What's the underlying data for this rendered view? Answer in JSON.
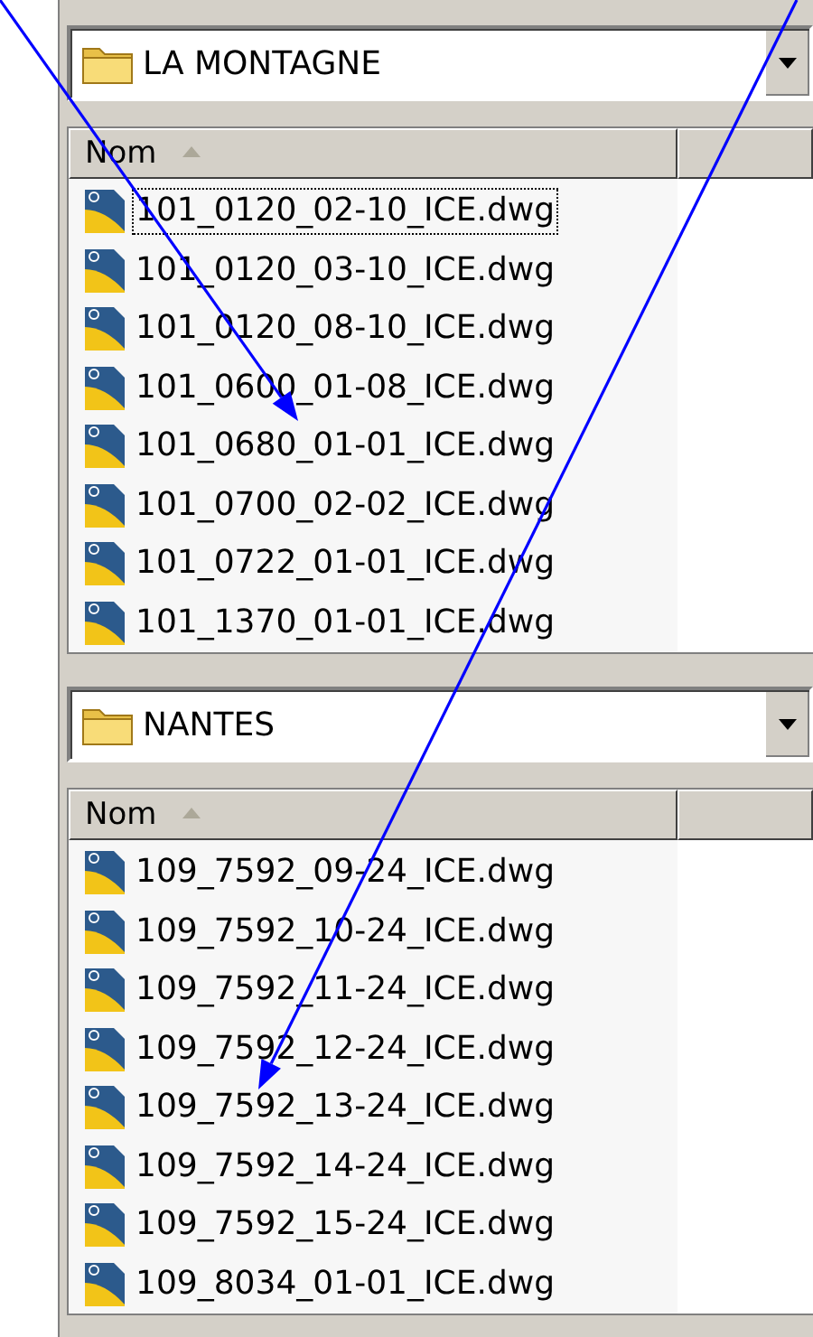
{
  "panels": [
    {
      "location": "LA MONTAGNE",
      "column": {
        "label": "Nom",
        "sorted_ascending": true
      },
      "files": [
        {
          "name": "101_0120_02-10_ICE.dwg",
          "focused": true
        },
        {
          "name": "101_0120_03-10_ICE.dwg",
          "focused": false
        },
        {
          "name": "101_0120_08-10_ICE.dwg",
          "focused": false
        },
        {
          "name": "101_0600_01-08_ICE.dwg",
          "focused": false
        },
        {
          "name": "101_0680_01-01_ICE.dwg",
          "focused": false
        },
        {
          "name": "101_0700_02-02_ICE.dwg",
          "focused": false
        },
        {
          "name": "101_0722_01-01_ICE.dwg",
          "focused": false
        },
        {
          "name": "101_1370_01-01_ICE.dwg",
          "focused": false
        }
      ]
    },
    {
      "location": "NANTES",
      "column": {
        "label": "Nom",
        "sorted_ascending": true
      },
      "files": [
        {
          "name": "109_7592_09-24_ICE.dwg",
          "focused": false
        },
        {
          "name": "109_7592_10-24_ICE.dwg",
          "focused": false
        },
        {
          "name": "109_7592_11-24_ICE.dwg",
          "focused": false
        },
        {
          "name": "109_7592_12-24_ICE.dwg",
          "focused": false
        },
        {
          "name": "109_7592_13-24_ICE.dwg",
          "focused": false
        },
        {
          "name": "109_7592_14-24_ICE.dwg",
          "focused": false
        },
        {
          "name": "109_7592_15-24_ICE.dwg",
          "focused": false
        },
        {
          "name": "109_8034_01-01_ICE.dwg",
          "focused": false
        }
      ]
    }
  ]
}
